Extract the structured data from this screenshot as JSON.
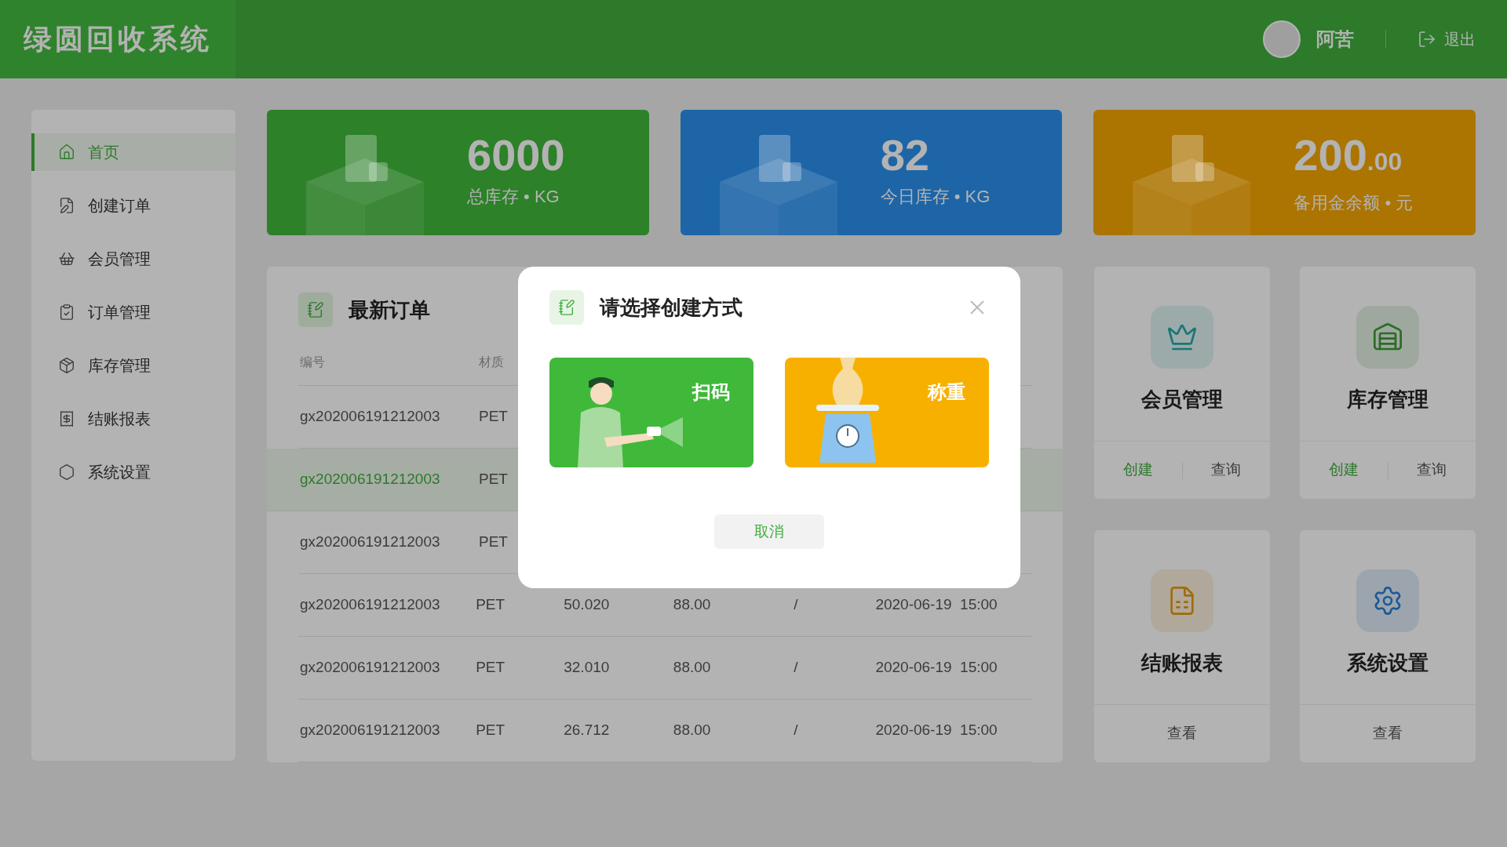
{
  "header": {
    "logo": "绿圆回收系统",
    "user": "阿苦",
    "logout": "退出"
  },
  "sidebar": {
    "items": [
      {
        "label": "首页",
        "selected": true
      },
      {
        "label": "创建订单",
        "selected": false
      },
      {
        "label": "会员管理",
        "selected": false
      },
      {
        "label": "订单管理",
        "selected": false
      },
      {
        "label": "库存管理",
        "selected": false
      },
      {
        "label": "结账报表",
        "selected": false
      },
      {
        "label": "系统设置",
        "selected": false
      }
    ]
  },
  "stats": [
    {
      "value": "6000",
      "caption": "总库存 • KG",
      "color": "#2d8129"
    },
    {
      "value": "82",
      "caption": "今日库存 • KG",
      "color": "#1d65a7"
    },
    {
      "value": "200",
      "decimals": ".00",
      "caption": "备用金余额 • 元",
      "color": "#ac7400"
    }
  ],
  "orders": {
    "title": "最新订单",
    "columns": [
      "编号",
      "材质"
    ],
    "rows": [
      {
        "selected": false,
        "cells": [
          "gx202006191212003",
          "PET"
        ]
      },
      {
        "selected": true,
        "cells": [
          "gx202006191212003",
          "PET"
        ]
      },
      {
        "selected": false,
        "cells": [
          "gx202006191212003",
          "PET"
        ]
      },
      {
        "selected": false,
        "cells": [
          "gx202006191212003",
          "PET",
          "50.020",
          "88.00",
          "/",
          "2020-06-19  15:00"
        ]
      },
      {
        "selected": false,
        "cells": [
          "gx202006191212003",
          "PET",
          "32.010",
          "88.00",
          "/",
          "2020-06-19  15:00"
        ]
      },
      {
        "selected": false,
        "cells": [
          "gx202006191212003",
          "PET",
          "26.712",
          "88.00",
          "/",
          "2020-06-19  15:00"
        ]
      }
    ]
  },
  "shortcuts": [
    {
      "title": "会员管理",
      "color": "#187676",
      "actions": [
        {
          "label": "创建",
          "primary": true
        },
        {
          "label": "查询",
          "primary": false
        }
      ]
    },
    {
      "title": "库存管理",
      "color": "#296c25",
      "actions": [
        {
          "label": "创建",
          "primary": true
        },
        {
          "label": "查询",
          "primary": false
        }
      ]
    },
    {
      "title": "结账报表",
      "color": "#a06c0b",
      "actions": [
        {
          "label": "查看",
          "primary": false
        }
      ]
    },
    {
      "title": "系统设置",
      "color": "#1d5994",
      "actions": [
        {
          "label": "查看",
          "primary": false
        }
      ]
    }
  ],
  "dialog": {
    "title": "请选择创建方式",
    "options": [
      {
        "kind": "scan",
        "label": "扫码"
      },
      {
        "kind": "weigh",
        "label": "称重"
      }
    ],
    "cancel": "取消"
  }
}
